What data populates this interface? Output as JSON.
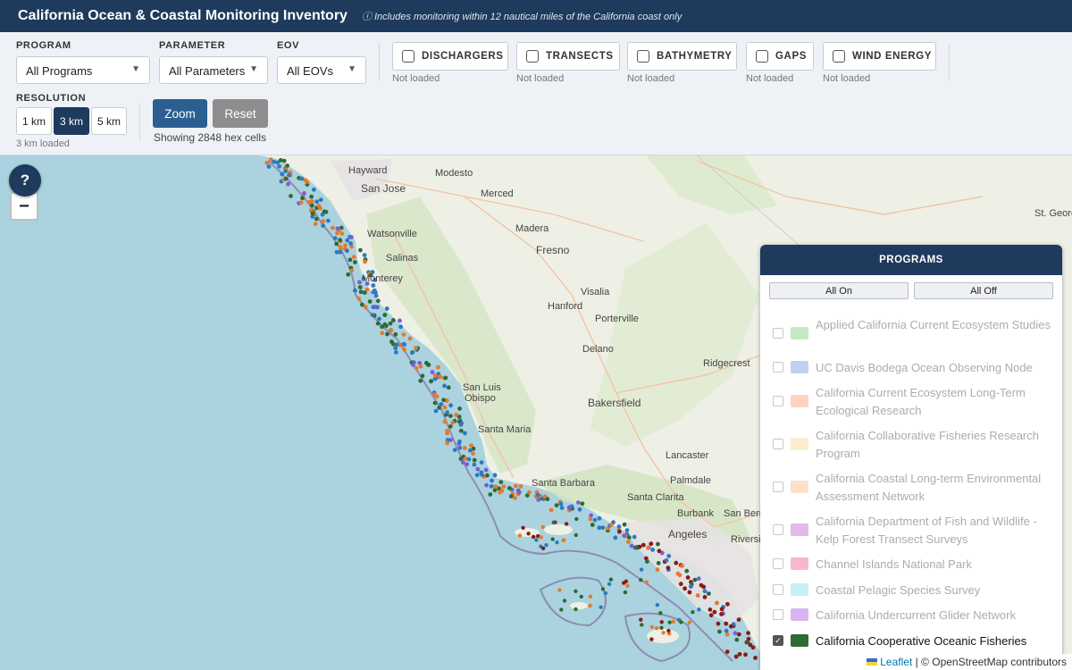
{
  "header": {
    "title": "California Ocean & Coastal Monitoring Inventory",
    "note": "ⓘ Includes monitoring within 12 nautical miles of the California coast only"
  },
  "filters": {
    "program": {
      "label": "PROGRAM",
      "value": "All Programs"
    },
    "parameter": {
      "label": "PARAMETER",
      "value": "All Parameters"
    },
    "eov": {
      "label": "EOV",
      "value": "All EOVs"
    }
  },
  "layers": [
    {
      "label": "DISCHARGERS",
      "status": "Not loaded"
    },
    {
      "label": "TRANSECTS",
      "status": "Not loaded"
    },
    {
      "label": "BATHYMETRY",
      "status": "Not loaded"
    },
    {
      "label": "GAPS",
      "status": "Not loaded"
    },
    {
      "label": "WIND ENERGY",
      "status": "Not loaded"
    }
  ],
  "resolution": {
    "label": "RESOLUTION",
    "options": [
      "1 km",
      "3 km",
      "5 km"
    ],
    "selected": "3 km",
    "status": "3 km loaded"
  },
  "actions": {
    "zoom": "Zoom",
    "reset": "Reset",
    "status": "Showing 2848 hex cells"
  },
  "map": {
    "help": "?",
    "zoom_out": "−",
    "cities": [
      "Hayward",
      "Modesto",
      "San Jose",
      "Merced",
      "Watsonville",
      "Salinas",
      "Madera",
      "Fresno",
      "Monterey",
      "Visalia",
      "Hanford",
      "Porterville",
      "Delano",
      "Ridgecrest",
      "San Luis",
      "Obispo",
      "Bakersfield",
      "Santa Maria",
      "Lancaster",
      "Palmdale",
      "Santa Barbara",
      "Santa Clarita",
      "Burbank",
      "San Berr",
      "Riversi",
      "Angeles",
      "St. Georg"
    ],
    "attribution_link": "Leaflet",
    "attribution_text": "| © OpenStreetMap contributors"
  },
  "programs_panel": {
    "title": "PROGRAMS",
    "all_on": "All On",
    "all_off": "All Off",
    "items": [
      {
        "name": "Applied California Current Ecosystem Studies",
        "color": "#c5e8c5",
        "checked": false
      },
      {
        "name": "UC Davis Bodega Ocean Observing Node",
        "color": "#c4cdf2",
        "checked": false
      },
      {
        "name": "California Current Ecosystem Long-Term Ecological Research",
        "color": "#fdd3bd",
        "checked": false
      },
      {
        "name": "California Collaborative Fisheries Research Program",
        "color": "#fbecd2",
        "checked": false
      },
      {
        "name": "California Coastal Long-term Environmental Assessment Network",
        "color": "#fde0c9",
        "checked": false
      },
      {
        "name": "California Department of Fish and Wildlife - Kelp Forest Transect Surveys",
        "color": "#e3b8ea",
        "checked": false
      },
      {
        "name": "Channel Islands National Park",
        "color": "#f9b8c8",
        "checked": false
      },
      {
        "name": "Coastal Pelagic Species Survey",
        "color": "#c8f0f6",
        "checked": false
      },
      {
        "name": "California Undercurrent Glider Network",
        "color": "#d9b4f3",
        "checked": false
      },
      {
        "name": "California Cooperative Oceanic Fisheries",
        "color": "#2e6b35",
        "checked": true
      }
    ]
  }
}
